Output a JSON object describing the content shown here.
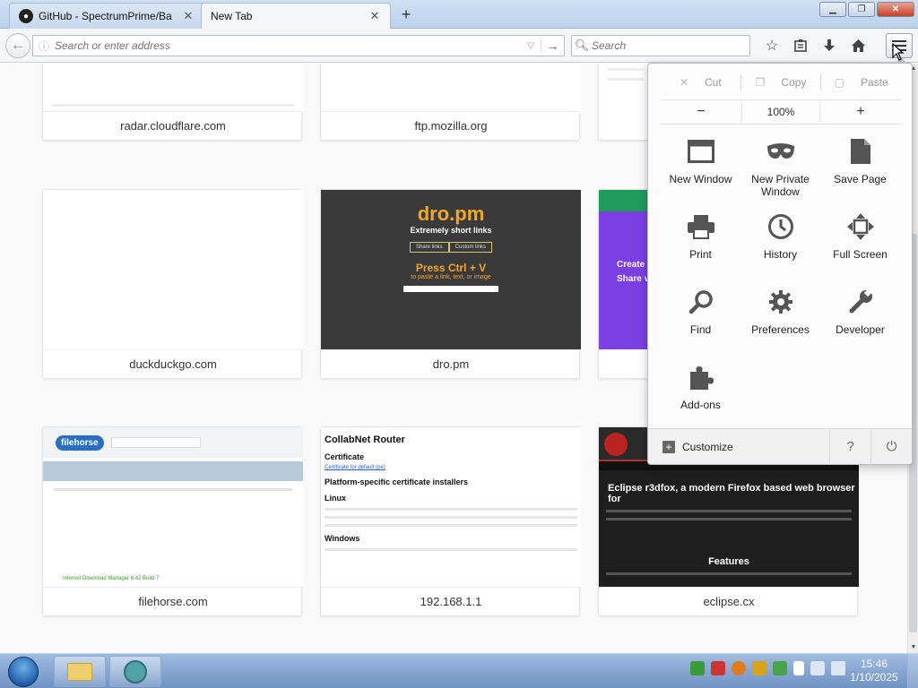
{
  "tabs": [
    {
      "title": "GitHub - SpectrumPrime/Ba",
      "favicon": "github-icon",
      "active": false
    },
    {
      "title": "New Tab",
      "active": true
    }
  ],
  "nav": {
    "url_placeholder": "Search or enter address",
    "search_placeholder": "Search"
  },
  "tiles": [
    {
      "label": "radar.cloudflare.com"
    },
    {
      "label": "ftp.mozilla.org"
    },
    {
      "label": "duckduckgo.com"
    },
    {
      "label": "dro.pm"
    },
    {
      "label": "filehorse.com"
    },
    {
      "label": "192.168.1.1"
    },
    {
      "label": "eclipse.cx"
    }
  ],
  "thumbnails": {
    "dro": {
      "title": "dro.pm",
      "subtitle": "Extremely short links",
      "tab1": "Share links",
      "tab2": "Custom links",
      "press": "Press Ctrl + V",
      "press_sub": "to paste a link, text, or image"
    },
    "purple": {
      "line1": "Create",
      "line2": "Share v"
    },
    "router": {
      "title": "CollabNet Router",
      "h_cert": "Certificate",
      "link": "Certificate for default (pe)",
      "h_platform": "Platform-specific certificate installers",
      "h_linux": "Linux",
      "h_windows": "Windows"
    },
    "eclipse": {
      "title": "Eclipse r3dfox, a modern Firefox based web browser for",
      "features": "Features"
    },
    "filehorse": {
      "logo": "filehorse",
      "green": "Internet Download Manager 6.42 Build 7"
    }
  },
  "menu": {
    "cut": "Cut",
    "copy": "Copy",
    "paste": "Paste",
    "zoom_out": "−",
    "zoom_level": "100%",
    "zoom_in": "+",
    "items": [
      {
        "label": "New Window",
        "icon": "new-window-icon"
      },
      {
        "label": "New Private Window",
        "icon": "private-mask-icon"
      },
      {
        "label": "Save Page",
        "icon": "save-page-icon"
      },
      {
        "label": "Print",
        "icon": "printer-icon"
      },
      {
        "label": "History",
        "icon": "clock-icon"
      },
      {
        "label": "Full Screen",
        "icon": "fullscreen-icon"
      },
      {
        "label": "Find",
        "icon": "magnifier-icon"
      },
      {
        "label": "Preferences",
        "icon": "gear-icon"
      },
      {
        "label": "Developer",
        "icon": "wrench-icon"
      },
      {
        "label": "Add-ons",
        "icon": "puzzle-icon"
      }
    ],
    "customize": "Customize"
  },
  "taskbar": {
    "time": "15:46",
    "date": "1/10/2025"
  }
}
